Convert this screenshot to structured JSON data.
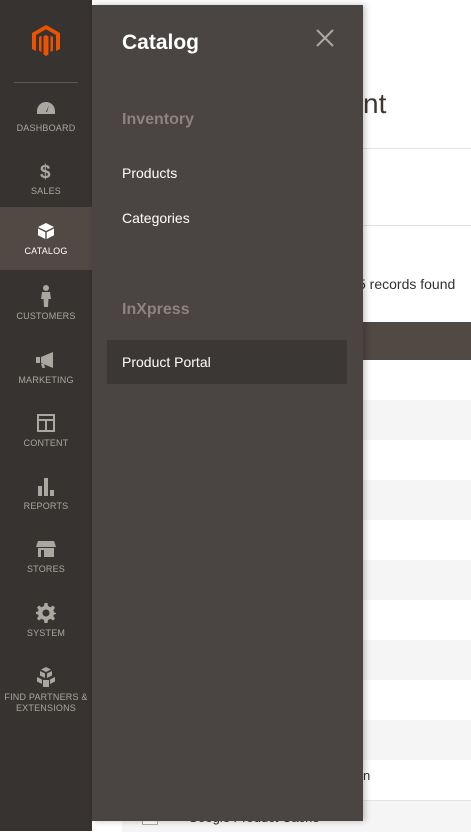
{
  "nav": {
    "items": [
      {
        "label": "DASHBOARD",
        "icon": "dashboard-gauge-icon"
      },
      {
        "label": "SALES",
        "icon": "dollar-icon"
      },
      {
        "label": "CATALOG",
        "icon": "cube-icon"
      },
      {
        "label": "CUSTOMERS",
        "icon": "person-icon"
      },
      {
        "label": "MARKETING",
        "icon": "megaphone-icon"
      },
      {
        "label": "CONTENT",
        "icon": "layout-icon"
      },
      {
        "label": "REPORTS",
        "icon": "bar-chart-icon"
      },
      {
        "label": "STORES",
        "icon": "storefront-icon"
      },
      {
        "label": "SYSTEM",
        "icon": "gear-icon"
      },
      {
        "label": "FIND PARTNERS & EXTENSIONS",
        "icon": "cubes-icon"
      }
    ],
    "active": "CATALOG",
    "colors": {
      "background": "#373330",
      "active": "#514943",
      "logo": "#eb5202"
    }
  },
  "flyout": {
    "title": "Catalog",
    "groups": [
      {
        "title": "Inventory",
        "links": [
          "Products",
          "Categories"
        ]
      },
      {
        "title": "InXpress",
        "links": [
          "Product Portal"
        ]
      }
    ],
    "highlighted_link": "Product Portal",
    "colors": {
      "background": "#4a4542",
      "group_title": "#8c8480"
    }
  },
  "page": {
    "title_fragment": "nt",
    "records_fragment": "5 records found",
    "row_fragment": "n",
    "bottom_row_fragment": "Google Product Cache"
  }
}
